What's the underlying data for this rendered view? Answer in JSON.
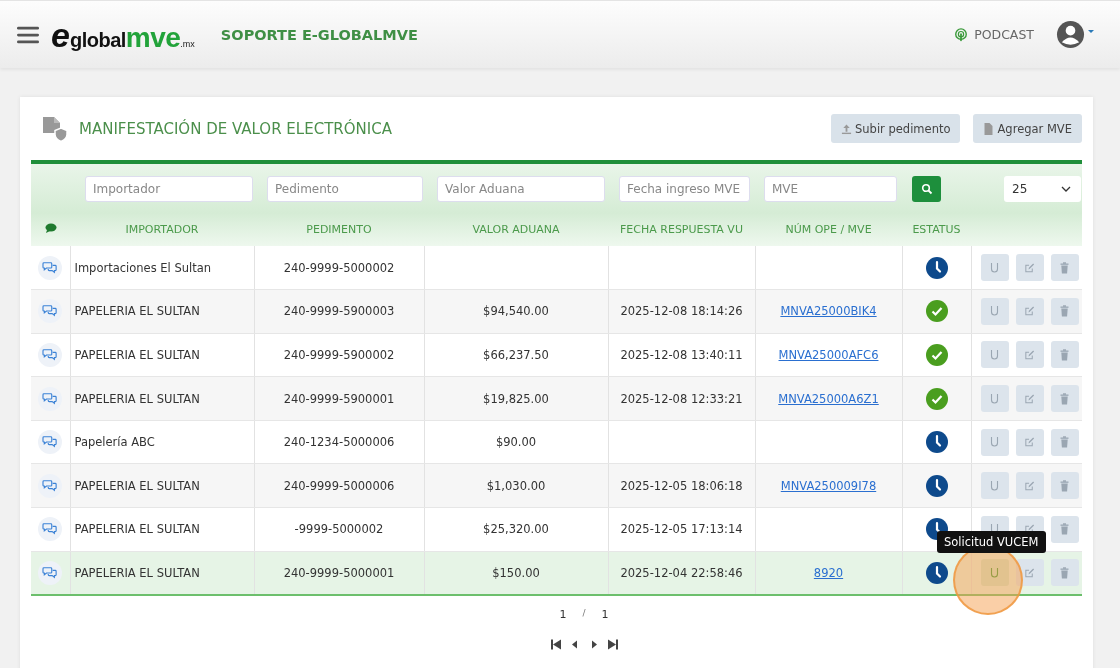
{
  "header": {
    "logo": {
      "letter": "e",
      "word": "global",
      "accent": "mve",
      "suffix": ".mx"
    },
    "title": "SOPORTE E-GLOBALMVE",
    "podcast": "PODCAST"
  },
  "page": {
    "title": "MANIFESTACIÓN DE VALOR ELECTRÓNICA",
    "buttons": [
      "Subir pedimento",
      "Agregar MVE"
    ]
  },
  "filters": {
    "fields": [
      {
        "placeholder": "Importador"
      },
      {
        "placeholder": "Pedimento"
      },
      {
        "placeholder": "Valor Aduana"
      },
      {
        "placeholder": "Fecha ingreso MVE"
      },
      {
        "placeholder": "MVE"
      }
    ],
    "page_size": "25"
  },
  "table": {
    "columns": [
      "IMPORTADOR",
      "PEDIMENTO",
      "VALOR ADUANA",
      "FECHA RESPUESTA VU",
      "NÚM OPE / MVE",
      "ESTATUS"
    ],
    "rows": [
      {
        "importador": "Importaciones El Sultan",
        "pedimento": "240-9999-5000002",
        "valor": "",
        "fecha": "",
        "mve": "",
        "kind": "pending",
        "selected": false
      },
      {
        "importador": "PAPELERIA EL SULTAN",
        "pedimento": "240-9999-5900003",
        "valor": "$94,540.00",
        "fecha": "2025-12-08 18:14:26",
        "mve": "MNVA25000BIK4",
        "kind": "approved",
        "selected": false
      },
      {
        "importador": "PAPELERIA EL SULTAN",
        "pedimento": "240-9999-5900002",
        "valor": "$66,237.50",
        "fecha": "2025-12-08 13:40:11",
        "mve": "MNVA25000AFC6",
        "kind": "approved",
        "selected": false
      },
      {
        "importador": "PAPELERIA EL SULTAN",
        "pedimento": "240-9999-5900001",
        "valor": "$19,825.00",
        "fecha": "2025-12-08 12:33:21",
        "mve": "MNVA25000A6Z1",
        "kind": "approved",
        "selected": false
      },
      {
        "importador": "Papelería ABC",
        "pedimento": "240-1234-5000006",
        "valor": "$90.00",
        "fecha": "",
        "mve": "",
        "kind": "pending",
        "selected": false
      },
      {
        "importador": "PAPELERIA EL SULTAN",
        "pedimento": "240-9999-5000006",
        "valor": "$1,030.00",
        "fecha": "2025-12-05 18:06:18",
        "mve": "MNVA250009I78",
        "kind": "pending",
        "selected": false
      },
      {
        "importador": "PAPELERIA EL SULTAN",
        "pedimento": "-9999-5000002",
        "valor": "$25,320.00",
        "fecha": "2025-12-05 17:13:14",
        "mve": "",
        "kind": "pending",
        "selected": false
      },
      {
        "importador": "PAPELERIA EL SULTAN",
        "pedimento": "240-9999-5000001",
        "valor": "$150.00",
        "fecha": "2025-12-04 22:58:46",
        "mve": "8920",
        "kind": "pending",
        "selected": true,
        "tooltip": "Solicitud VUCEM"
      }
    ]
  },
  "pagination": {
    "current": "1",
    "separator": "/",
    "total": "1"
  }
}
